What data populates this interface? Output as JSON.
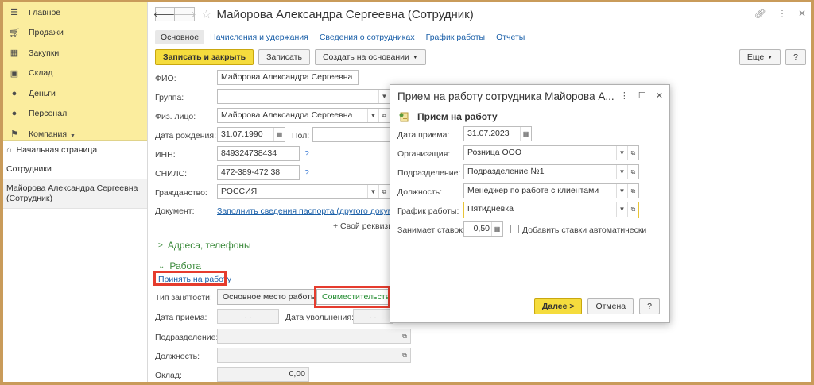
{
  "sidebar": {
    "sections": [
      {
        "label": "Главное",
        "icon": "hamburger-icon"
      },
      {
        "label": "Продажи",
        "icon": "cart-icon"
      },
      {
        "label": "Закупки",
        "icon": "purchase-icon"
      },
      {
        "label": "Склад",
        "icon": "warehouse-icon"
      },
      {
        "label": "Деньги",
        "icon": "money-icon"
      },
      {
        "label": "Персонал",
        "icon": "person-icon"
      },
      {
        "label": "Компания",
        "icon": "flag-icon"
      }
    ],
    "open_windows": [
      {
        "label": "Начальная страница"
      },
      {
        "label": "Сотрудники"
      },
      {
        "label": "Майорова Александра Сергеевна (Сотрудник)"
      }
    ]
  },
  "header": {
    "title": "Майорова Александра Сергеевна (Сотрудник)"
  },
  "tabs": [
    {
      "label": "Основное"
    },
    {
      "label": "Начисления и удержания"
    },
    {
      "label": "Сведения о сотрудниках"
    },
    {
      "label": "График работы"
    },
    {
      "label": "Отчеты"
    }
  ],
  "toolbar": {
    "save_close": "Записать и закрыть",
    "save": "Записать",
    "create_based": "Создать на основании",
    "more": "Еще",
    "help": "?"
  },
  "form": {
    "fio_label": "ФИО:",
    "fio_value": "Майорова Александра Сергеевна",
    "group_label": "Группа:",
    "group_value": "",
    "person_label": "Физ. лицо:",
    "person_value": "Майорова Александра Сергеевна",
    "dob_label": "Дата рождения:",
    "dob_value": "31.07.1990",
    "sex_label": "Пол:",
    "sex_value": "",
    "inn_label": "ИНН:",
    "inn_value": "849324738434",
    "snils_label": "СНИЛС:",
    "snils_value": "472-389-472 38",
    "citizenship_label": "Гражданство:",
    "citizenship_value": "РОССИЯ",
    "document_label": "Документ:",
    "document_link": "Заполнить сведения паспорта (другого документа",
    "other_details": "+ Свой реквизит",
    "q": "?"
  },
  "groups": {
    "addresses": "Адреса, телефоны",
    "work": "Работа"
  },
  "work": {
    "hire_link": "Принять на работу",
    "employment_type_label": "Тип занятости:",
    "main_place": "Основное место работы",
    "part_time": "Совместительство",
    "hire_date_label": "Дата приема:",
    "hire_date_value": ". .",
    "dismissal_label": "Дата увольнения:",
    "dismissal_value": ". .",
    "department_label": "Подразделение:",
    "position_label": "Должность:",
    "salary_label": "Оклад:",
    "salary_value": "0,00"
  },
  "dialog": {
    "title": "Прием на работу сотрудника Майорова А...",
    "heading": "Прием на работу",
    "hire_date_label": "Дата приема:",
    "hire_date_value": "31.07.2023",
    "org_label": "Организация:",
    "org_value": "Розница ООО",
    "dept_label": "Подразделение:",
    "dept_value": "Подразделение №1",
    "position_label": "Должность:",
    "position_value": "Менеджер по работе с клиентами",
    "schedule_label": "График работы:",
    "schedule_value": "Пятидневка",
    "rates_label": "Занимает ставок:",
    "rates_value": "0,50",
    "auto_rates_label": "Добавить ставки автоматически",
    "next": "Далее >",
    "cancel": "Отмена",
    "help": "?"
  },
  "colors": {
    "sidebar_bg": "#fbed9e",
    "primary_button": "#f5dc3d",
    "link": "#1a5fa8",
    "highlight": "#e53c2e",
    "group_green": "#3b8a3b"
  }
}
